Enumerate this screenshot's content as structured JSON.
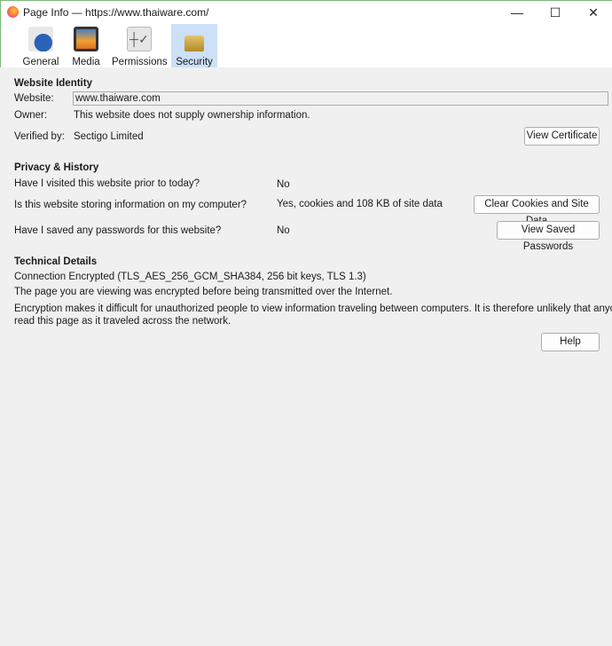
{
  "window": {
    "title": "Page Info — https://www.thaiware.com/",
    "minimize": "—",
    "maximize": "☐",
    "close": "✕"
  },
  "tabs": [
    {
      "label": "General",
      "icon": "info-icon"
    },
    {
      "label": "Media",
      "icon": "media-icon"
    },
    {
      "label": "Permissions",
      "icon": "permissions-icon"
    },
    {
      "label": "Security",
      "icon": "lock-icon",
      "selected": true
    }
  ],
  "identity": {
    "heading": "Website Identity",
    "website_label": "Website:",
    "website_value": "www.thaiware.com",
    "owner_label": "Owner:",
    "owner_value": "This website does not supply ownership information.",
    "verified_label": "Verified by:",
    "verified_value": "Sectigo Limited",
    "view_certificate": "View Certificate"
  },
  "privacy": {
    "heading": "Privacy & History",
    "q1": "Have I visited this website prior to today?",
    "a1": "No",
    "q2": "Is this website storing information on my computer?",
    "a2": "Yes, cookies and 108 KB of site data",
    "clear_button": "Clear Cookies and Site Data",
    "q3": "Have I saved any passwords for this website?",
    "a3": "No",
    "passwords_button": "View Saved Passwords"
  },
  "technical": {
    "heading": "Technical Details",
    "line1": "Connection Encrypted (TLS_AES_256_GCM_SHA384, 256 bit keys, TLS 1.3)",
    "line2": "The page you are viewing was encrypted before being transmitted over the Internet.",
    "line3a": "Encryption makes it difficult for unauthorized people to view information traveling between computers. It is therefore unlikely that anyone",
    "line3b": "read this page as it traveled across the network."
  },
  "help_button": "Help"
}
